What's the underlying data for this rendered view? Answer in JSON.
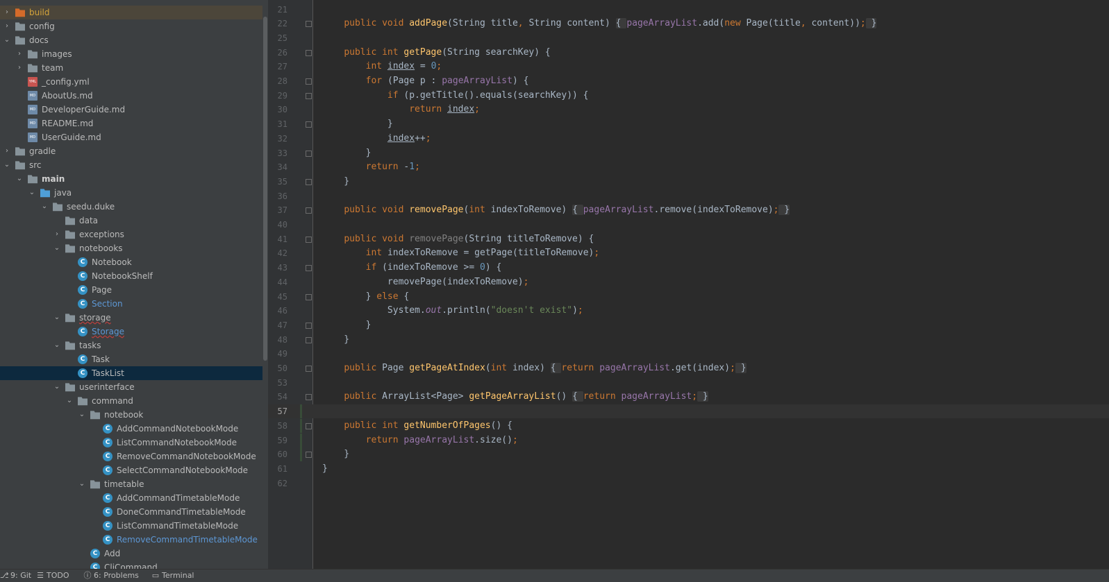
{
  "project_tree": [
    {
      "label": "build",
      "depth": 0,
      "arrow": "right",
      "icon": "folder-build-icon",
      "style": "build",
      "highlight": true
    },
    {
      "label": "config",
      "depth": 0,
      "arrow": "right",
      "icon": "folder-icon"
    },
    {
      "label": "docs",
      "depth": 0,
      "arrow": "down",
      "icon": "folder-icon"
    },
    {
      "label": "images",
      "depth": 1,
      "arrow": "right",
      "icon": "folder-icon"
    },
    {
      "label": "team",
      "depth": 1,
      "arrow": "right",
      "icon": "folder-icon"
    },
    {
      "label": "_config.yml",
      "depth": 1,
      "arrow": "",
      "icon": "yml-file-icon"
    },
    {
      "label": "AboutUs.md",
      "depth": 1,
      "arrow": "",
      "icon": "md-file-icon"
    },
    {
      "label": "DeveloperGuide.md",
      "depth": 1,
      "arrow": "",
      "icon": "md-file-icon"
    },
    {
      "label": "README.md",
      "depth": 1,
      "arrow": "",
      "icon": "md-file-icon"
    },
    {
      "label": "UserGuide.md",
      "depth": 1,
      "arrow": "",
      "icon": "md-file-icon"
    },
    {
      "label": "gradle",
      "depth": 0,
      "arrow": "right",
      "icon": "folder-icon"
    },
    {
      "label": "src",
      "depth": 0,
      "arrow": "down",
      "icon": "folder-icon"
    },
    {
      "label": "main",
      "depth": 1,
      "arrow": "down",
      "icon": "folder-icon",
      "style": "bold"
    },
    {
      "label": "java",
      "depth": 2,
      "arrow": "down",
      "icon": "source-folder-icon"
    },
    {
      "label": "seedu.duke",
      "depth": 3,
      "arrow": "down",
      "icon": "package-icon"
    },
    {
      "label": "data",
      "depth": 4,
      "arrow": "",
      "icon": "package-icon"
    },
    {
      "label": "exceptions",
      "depth": 4,
      "arrow": "right",
      "icon": "package-icon"
    },
    {
      "label": "notebooks",
      "depth": 4,
      "arrow": "down",
      "icon": "package-icon"
    },
    {
      "label": "Notebook",
      "depth": 5,
      "arrow": "",
      "icon": "class-icon"
    },
    {
      "label": "NotebookShelf",
      "depth": 5,
      "arrow": "",
      "icon": "class-icon"
    },
    {
      "label": "Page",
      "depth": 5,
      "arrow": "",
      "icon": "class-icon"
    },
    {
      "label": "Section",
      "depth": 5,
      "arrow": "",
      "icon": "class-icon",
      "style": "blue"
    },
    {
      "label": "storage",
      "depth": 4,
      "arrow": "down",
      "icon": "package-icon",
      "style": "wavy"
    },
    {
      "label": "Storage",
      "depth": 5,
      "arrow": "",
      "icon": "class-icon",
      "style": "blue wavy"
    },
    {
      "label": "tasks",
      "depth": 4,
      "arrow": "down",
      "icon": "package-icon"
    },
    {
      "label": "Task",
      "depth": 5,
      "arrow": "",
      "icon": "class-icon"
    },
    {
      "label": "TaskList",
      "depth": 5,
      "arrow": "",
      "icon": "class-icon",
      "selected": true
    },
    {
      "label": "userinterface",
      "depth": 4,
      "arrow": "down",
      "icon": "package-icon"
    },
    {
      "label": "command",
      "depth": 5,
      "arrow": "down",
      "icon": "package-icon"
    },
    {
      "label": "notebook",
      "depth": 6,
      "arrow": "down",
      "icon": "package-icon"
    },
    {
      "label": "AddCommandNotebookMode",
      "depth": 7,
      "arrow": "",
      "icon": "class-icon"
    },
    {
      "label": "ListCommandNotebookMode",
      "depth": 7,
      "arrow": "",
      "icon": "class-icon"
    },
    {
      "label": "RemoveCommandNotebookMode",
      "depth": 7,
      "arrow": "",
      "icon": "class-icon"
    },
    {
      "label": "SelectCommandNotebookMode",
      "depth": 7,
      "arrow": "",
      "icon": "class-icon"
    },
    {
      "label": "timetable",
      "depth": 6,
      "arrow": "down",
      "icon": "package-icon"
    },
    {
      "label": "AddCommandTimetableMode",
      "depth": 7,
      "arrow": "",
      "icon": "class-icon"
    },
    {
      "label": "DoneCommandTimetableMode",
      "depth": 7,
      "arrow": "",
      "icon": "class-icon"
    },
    {
      "label": "ListCommandTimetableMode",
      "depth": 7,
      "arrow": "",
      "icon": "class-icon"
    },
    {
      "label": "RemoveCommandTimetableMode",
      "depth": 7,
      "arrow": "",
      "icon": "class-icon",
      "style": "blue"
    },
    {
      "label": "Add",
      "depth": 6,
      "arrow": "",
      "icon": "class-icon"
    },
    {
      "label": "CliCommand",
      "depth": 6,
      "arrow": "",
      "icon": "class-icon"
    }
  ],
  "editor": {
    "current_line": "57",
    "lines": [
      {
        "n": "21",
        "fold": false,
        "segs": []
      },
      {
        "n": "22",
        "fold": true,
        "segs": [
          [
            "    ",
            ""
          ],
          [
            "public void ",
            "kw"
          ],
          [
            "addPage",
            "fn"
          ],
          [
            "(String title",
            ""
          ],
          [
            ", ",
            "kw"
          ],
          [
            "String content) ",
            ""
          ],
          [
            "{ ",
            "fb"
          ],
          [
            "pageArrayList",
            "fld"
          ],
          [
            ".add(",
            ""
          ],
          [
            "new ",
            "kw"
          ],
          [
            "Page(title",
            ""
          ],
          [
            ", ",
            "kw"
          ],
          [
            "content))",
            ""
          ],
          [
            ";",
            "kw"
          ],
          [
            " }",
            "fb"
          ]
        ]
      },
      {
        "n": "25",
        "fold": false,
        "segs": []
      },
      {
        "n": "26",
        "fold": true,
        "segs": [
          [
            "    ",
            ""
          ],
          [
            "public int ",
            "kw"
          ],
          [
            "getPage",
            "fn"
          ],
          [
            "(String searchKey) {",
            ""
          ]
        ]
      },
      {
        "n": "27",
        "fold": false,
        "segs": [
          [
            "        ",
            ""
          ],
          [
            "int ",
            "kw"
          ],
          [
            "index",
            "ul"
          ],
          [
            " = ",
            ""
          ],
          [
            "0",
            "num"
          ],
          [
            ";",
            "kw"
          ]
        ]
      },
      {
        "n": "28",
        "fold": true,
        "segs": [
          [
            "        ",
            ""
          ],
          [
            "for ",
            "kw"
          ],
          [
            "(Page p : ",
            ""
          ],
          [
            "pageArrayList",
            "fld"
          ],
          [
            ") {",
            ""
          ]
        ]
      },
      {
        "n": "29",
        "fold": true,
        "segs": [
          [
            "            ",
            ""
          ],
          [
            "if ",
            "kw"
          ],
          [
            "(p.getTitle().equals(searchKey)) {",
            ""
          ]
        ]
      },
      {
        "n": "30",
        "fold": false,
        "segs": [
          [
            "                ",
            ""
          ],
          [
            "return ",
            "kw"
          ],
          [
            "index",
            "ul"
          ],
          [
            ";",
            "kw"
          ]
        ]
      },
      {
        "n": "31",
        "fold": true,
        "segs": [
          [
            "            }",
            ""
          ]
        ]
      },
      {
        "n": "32",
        "fold": false,
        "segs": [
          [
            "            ",
            ""
          ],
          [
            "index",
            "ul"
          ],
          [
            "++",
            ""
          ],
          [
            ";",
            "kw"
          ]
        ]
      },
      {
        "n": "33",
        "fold": true,
        "segs": [
          [
            "        }",
            ""
          ]
        ]
      },
      {
        "n": "34",
        "fold": false,
        "segs": [
          [
            "        ",
            ""
          ],
          [
            "return ",
            "kw"
          ],
          [
            "-",
            ""
          ],
          [
            "1",
            "num"
          ],
          [
            ";",
            "kw"
          ]
        ]
      },
      {
        "n": "35",
        "fold": true,
        "segs": [
          [
            "    }",
            ""
          ]
        ]
      },
      {
        "n": "36",
        "fold": false,
        "segs": []
      },
      {
        "n": "37",
        "fold": true,
        "segs": [
          [
            "    ",
            ""
          ],
          [
            "public void ",
            "kw"
          ],
          [
            "removePage",
            "fn"
          ],
          [
            "(",
            ""
          ],
          [
            "int ",
            "kw"
          ],
          [
            "indexToRemove) ",
            ""
          ],
          [
            "{ ",
            "fb"
          ],
          [
            "pageArrayList",
            "fld"
          ],
          [
            ".remove(indexToRemove)",
            ""
          ],
          [
            ";",
            "kw"
          ],
          [
            " }",
            "fb"
          ]
        ]
      },
      {
        "n": "40",
        "fold": false,
        "segs": []
      },
      {
        "n": "41",
        "fold": true,
        "segs": [
          [
            "    ",
            ""
          ],
          [
            "public void ",
            "kw"
          ],
          [
            "removePage",
            "unused"
          ],
          [
            "(String titleToRemove) {",
            ""
          ]
        ]
      },
      {
        "n": "42",
        "fold": false,
        "segs": [
          [
            "        ",
            ""
          ],
          [
            "int ",
            "kw"
          ],
          [
            "indexToRemove = getPage(titleToRemove)",
            ""
          ],
          [
            ";",
            "kw"
          ]
        ]
      },
      {
        "n": "43",
        "fold": true,
        "segs": [
          [
            "        ",
            ""
          ],
          [
            "if ",
            "kw"
          ],
          [
            "(indexToRemove >= ",
            ""
          ],
          [
            "0",
            "num"
          ],
          [
            ") {",
            ""
          ]
        ]
      },
      {
        "n": "44",
        "fold": false,
        "segs": [
          [
            "            removePage(indexToRemove)",
            ""
          ],
          [
            ";",
            "kw"
          ]
        ]
      },
      {
        "n": "45",
        "fold": true,
        "segs": [
          [
            "        } ",
            ""
          ],
          [
            "else ",
            "kw"
          ],
          [
            "{",
            ""
          ]
        ]
      },
      {
        "n": "46",
        "fold": false,
        "segs": [
          [
            "            System.",
            ""
          ],
          [
            "out",
            "static"
          ],
          [
            ".println(",
            ""
          ],
          [
            "\"doesn't exist\"",
            "str"
          ],
          [
            ")",
            ""
          ],
          [
            ";",
            "kw"
          ]
        ]
      },
      {
        "n": "47",
        "fold": true,
        "segs": [
          [
            "        }",
            ""
          ]
        ]
      },
      {
        "n": "48",
        "fold": true,
        "segs": [
          [
            "    }",
            ""
          ]
        ]
      },
      {
        "n": "49",
        "fold": false,
        "segs": []
      },
      {
        "n": "50",
        "fold": true,
        "segs": [
          [
            "    ",
            ""
          ],
          [
            "public ",
            "kw"
          ],
          [
            "Page ",
            ""
          ],
          [
            "getPageAtIndex",
            "fn"
          ],
          [
            "(",
            ""
          ],
          [
            "int ",
            "kw"
          ],
          [
            "index) ",
            ""
          ],
          [
            "{ ",
            "fb"
          ],
          [
            "return ",
            "kw"
          ],
          [
            "pageArrayList",
            "fld"
          ],
          [
            ".get(index)",
            ""
          ],
          [
            ";",
            "kw"
          ],
          [
            " }",
            "fb"
          ]
        ]
      },
      {
        "n": "53",
        "fold": false,
        "segs": []
      },
      {
        "n": "54",
        "fold": true,
        "segs": [
          [
            "    ",
            ""
          ],
          [
            "public ",
            "kw"
          ],
          [
            "ArrayList<Page> ",
            ""
          ],
          [
            "getPageArrayList",
            "fn"
          ],
          [
            "() ",
            ""
          ],
          [
            "{ ",
            "fb"
          ],
          [
            "return ",
            "kw"
          ],
          [
            "pageArrayList",
            "fld"
          ],
          [
            ";",
            "kw"
          ],
          [
            " }",
            "fb"
          ]
        ]
      },
      {
        "n": "57",
        "fold": false,
        "segs": []
      },
      {
        "n": "58",
        "fold": true,
        "segs": [
          [
            "    ",
            ""
          ],
          [
            "public int ",
            "kw"
          ],
          [
            "getNumberOfPages",
            "fn"
          ],
          [
            "() {",
            ""
          ]
        ]
      },
      {
        "n": "59",
        "fold": false,
        "segs": [
          [
            "        ",
            ""
          ],
          [
            "return ",
            "kw"
          ],
          [
            "pageArrayList",
            "fld"
          ],
          [
            ".size()",
            ""
          ],
          [
            ";",
            "kw"
          ]
        ]
      },
      {
        "n": "60",
        "fold": true,
        "segs": [
          [
            "    }",
            ""
          ]
        ]
      },
      {
        "n": "61",
        "fold": false,
        "segs": [
          [
            "}",
            ""
          ]
        ]
      },
      {
        "n": "62",
        "fold": false,
        "segs": []
      }
    ]
  },
  "status_bar": {
    "git": "9: Git",
    "todo": "TODO",
    "problems": "6: Problems",
    "terminal": "Terminal"
  }
}
